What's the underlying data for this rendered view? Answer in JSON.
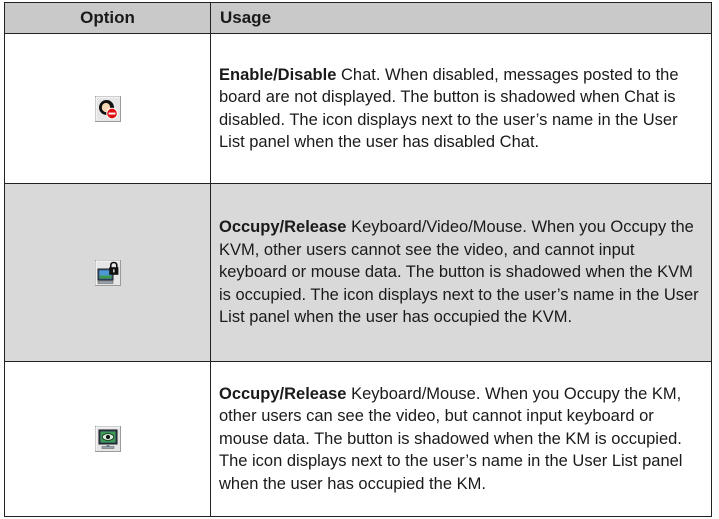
{
  "table": {
    "headers": {
      "option": "Option",
      "usage": "Usage"
    },
    "rows": [
      {
        "icon": "chat-disable-icon",
        "bold": "Enable/Disable",
        "text": " Chat. When disabled, messages posted to the board are not displayed. The button is shadowed when Chat is disabled. The icon displays next to the user’s name in the User List panel when the user has disabled Chat."
      },
      {
        "icon": "kvm-occupy-icon",
        "bold": "Occupy/Release",
        "text": " Keyboard/Video/Mouse. When you Occupy the KVM, other users cannot see the video, and cannot input keyboard or mouse data. The button is shadowed when the KVM is occupied. The icon displays next to the user’s name in the User List panel when the user has occupied the KVM."
      },
      {
        "icon": "km-occupy-icon",
        "bold": "Occupy/Release",
        "text": " Keyboard/Mouse. When you Occupy the KM, other users can see the video, but cannot input keyboard or mouse data. The button is shadowed when the KM is occupied. The icon displays next to the user’s name in the User List panel when the user has occupied the KM."
      }
    ]
  },
  "colors": {
    "header_bg": "#c9c9c9",
    "shaded_row_bg": "#d9d9d9",
    "border": "#222222",
    "icon_red": "#e01010",
    "icon_green": "#2a9a4a"
  }
}
